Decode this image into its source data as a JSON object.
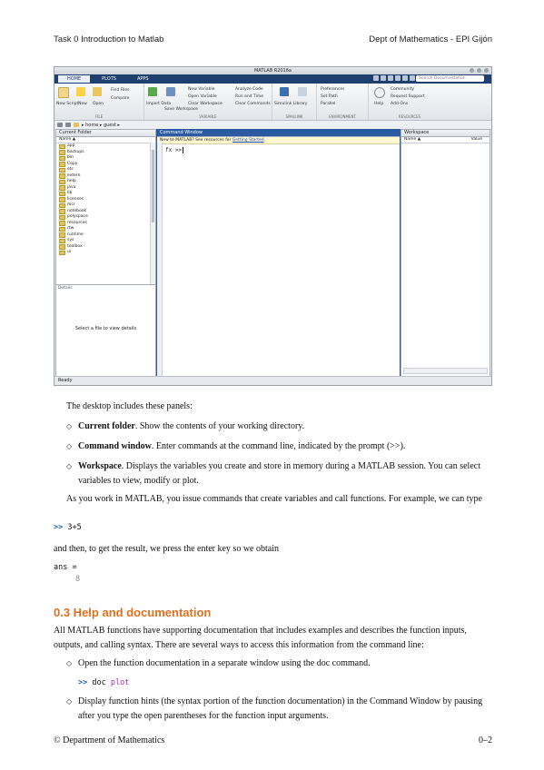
{
  "header": {
    "left": "Task 0  Introduction to Matlab",
    "right": "Dept of Mathematics - EPI Gijón"
  },
  "matlab": {
    "window_title": "MATLAB R2016a",
    "tabs": [
      "HOME",
      "PLOTS",
      "APPS"
    ],
    "search_placeholder": "Search Documentation",
    "ribbon": {
      "new_script": "New Script",
      "new": "New",
      "open": "Open",
      "find_files": "Find Files",
      "compare": "Compare",
      "import_data": "Import Data",
      "save_workspace": "Save Workspace",
      "new_variable": "New Variable",
      "open_variable": "Open Variable",
      "clear_workspace": "Clear Workspace",
      "analyze_code": "Analyze Code",
      "run_and_time": "Run and Time",
      "clear_commands": "Clear Commands",
      "simulink": "Simulink Library",
      "layout": "Layout",
      "preferences": "Preferences",
      "set_path": "Set Path",
      "parallel": "Parallel",
      "help": "Help",
      "community": "Community",
      "request_support": "Request Support",
      "add_ons": "Add-Ons",
      "groups": [
        "FILE",
        "VARIABLE",
        "CODE",
        "SIMULINK",
        "ENVIRONMENT",
        "RESOURCES"
      ]
    },
    "address": "▸ home ▸ guest ▸",
    "current_folder": {
      "title": "Current Folder",
      "col_name": "Name ▲",
      "items": [
        "app",
        "backups",
        "bin",
        "Copy",
        "etc",
        "extern",
        "help",
        "java",
        "lib",
        "licenses",
        "mcr",
        "notebook",
        "polyspace",
        "resources",
        "rtw",
        "runtime",
        "sys",
        "toolbox",
        "ui"
      ],
      "details_label": "Details",
      "details_msg": "Select a file to view details"
    },
    "command_window": {
      "title": "Command Window",
      "info_prefix": "New to MATLAB? See resources for ",
      "info_link1": "Getting Started",
      "info_mid": ".",
      "prompt": "fx >> "
    },
    "workspace": {
      "title": "Workspace",
      "col_name": "Name ▲",
      "col_value": "Value"
    },
    "status": "Ready"
  },
  "body": {
    "intro": "The desktop includes these panels:",
    "bullets": [
      {
        "term": "Current folder",
        "text": ". Show the contents of your working directory."
      },
      {
        "term": "Command window",
        "text": ". Enter commands at the command line, indicated by the prompt (>>)."
      },
      {
        "term": "Workspace",
        "text": ". Displays the variables you create and store in memory during a MATLAB session. You can select variables to view, modify or plot."
      }
    ],
    "para1": "As you work in MATLAB, you issue commands that create variables and call functions. For example, we can type",
    "code1_prompt": ">>",
    "code1_expr": "3+5",
    "para2": "and then, to get the result, we press the enter key so we obtain",
    "ans_label": "ans =",
    "ans_value": "8",
    "section": "0.3   Help and documentation",
    "para3": "All MATLAB functions have supporting documentation that includes examples and describes the function inputs, outputs, and calling syntax. There are several ways to access this information from the command line:",
    "help_bullets": [
      "Open the function documentation in a separate window using the doc command.",
      "Display function hints (the syntax portion of the function documentation) in the Command Window by pausing after you type the open parentheses for the function input arguments."
    ],
    "code2_prompt": ">>",
    "code2_cmd": "doc",
    "code2_arg": "plot"
  },
  "footer": {
    "left": "© Department of Mathematics",
    "right": "0–2"
  }
}
